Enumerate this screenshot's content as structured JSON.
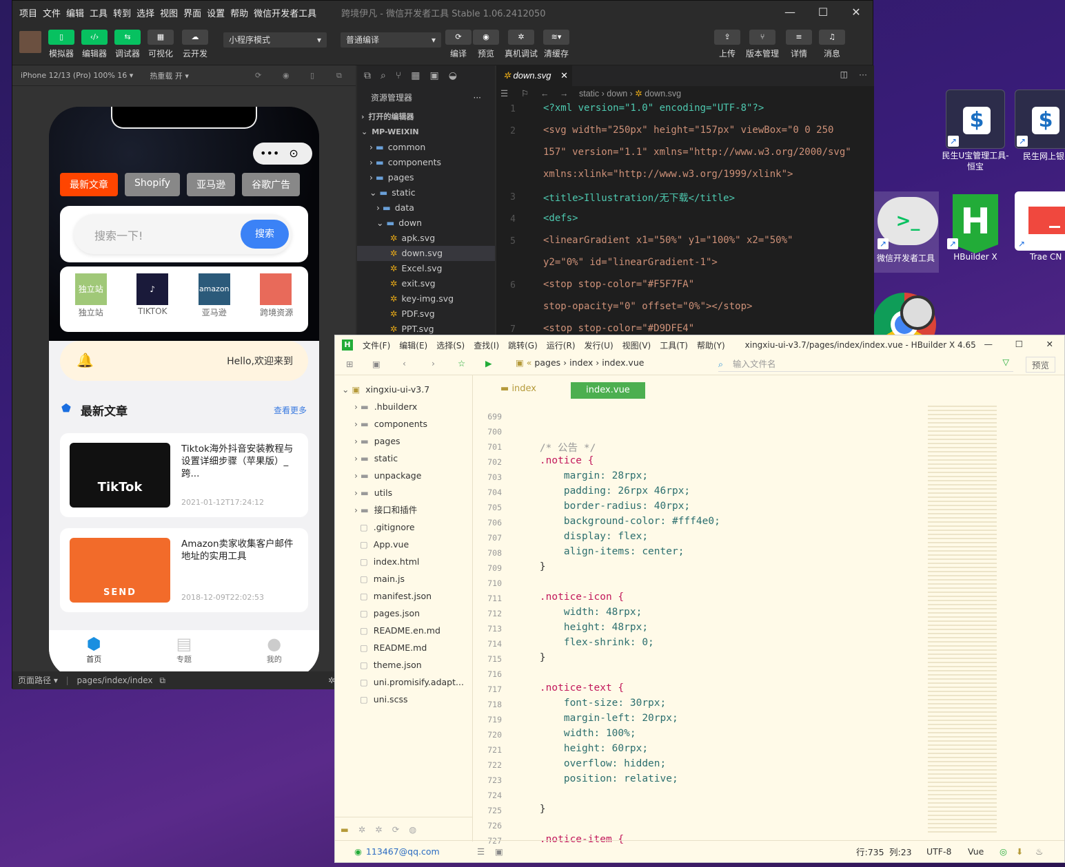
{
  "desktop": {
    "icons": [
      {
        "label": "民生U宝管理工具-恒宝",
        "color": "#ffffff"
      },
      {
        "label": "民生网上银",
        "color": "#ffffff"
      },
      {
        "label": "微信开发者工具",
        "color": "#e6e6e6"
      },
      {
        "label": "HBuilder X",
        "color": "#22ac38"
      },
      {
        "label": "Trae CN",
        "color": "#ffffff"
      }
    ]
  },
  "wx": {
    "menu": [
      "项目",
      "文件",
      "编辑",
      "工具",
      "转到",
      "选择",
      "视图",
      "界面",
      "设置",
      "帮助",
      "微信开发者工具"
    ],
    "title": "跨境伊凡 - 微信开发者工具 Stable 1.06.2412050",
    "toolbar": {
      "simulator": "模拟器",
      "editor": "编辑器",
      "debugger": "调试器",
      "visual": "可视化",
      "cloud": "云开发",
      "mode": "小程序模式",
      "compile_mode": "普通编译",
      "compile": "编译",
      "preview": "预览",
      "real_debug": "真机调试",
      "clear_cache": "清缓存",
      "upload": "上传",
      "version": "版本管理",
      "detail": "详情",
      "message": "消息"
    },
    "sim": {
      "device": "iPhone 12/13 (Pro) 100% 16 ▾",
      "hotreload": "热重载 开 ▾",
      "path_label": "页面路径 ▾",
      "path": "pages/index/index"
    },
    "phone": {
      "tabs": [
        "最新文章",
        "Shopify",
        "亚马逊",
        "谷歌广告"
      ],
      "search_placeholder": "搜索一下!",
      "search_btn": "搜索",
      "grid": [
        {
          "label": "独立站"
        },
        {
          "label": "TIKTOK"
        },
        {
          "label": "亚马逊"
        },
        {
          "label": "跨境资源"
        }
      ],
      "notice": "Hello,欢迎来到",
      "section_title": "最新文章",
      "more": "查看更多",
      "articles": [
        {
          "title": "Tiktok海外抖音安装教程与设置详细步骤（苹果版）_跨...",
          "date": "2021-01-12T17:24:12",
          "thumb": "TikTok"
        },
        {
          "title": "Amazon卖家收集客户邮件地址的实用工具",
          "date": "2018-12-09T22:02:53",
          "thumb": "SEND"
        }
      ],
      "tabbar": [
        "首页",
        "专题",
        "我的"
      ]
    },
    "explorer": {
      "title": "资源管理器",
      "items": [
        {
          "label": "打开的编辑器",
          "depth": 0,
          "kind": "section"
        },
        {
          "label": "MP-WEIXIN",
          "depth": 0,
          "kind": "section"
        },
        {
          "label": "common",
          "depth": 1,
          "kind": "folder"
        },
        {
          "label": "components",
          "depth": 1,
          "kind": "folder"
        },
        {
          "label": "pages",
          "depth": 1,
          "kind": "folder"
        },
        {
          "label": "static",
          "depth": 1,
          "kind": "folder-open"
        },
        {
          "label": "data",
          "depth": 2,
          "kind": "folder"
        },
        {
          "label": "down",
          "depth": 2,
          "kind": "folder-open"
        },
        {
          "label": "apk.svg",
          "depth": 3,
          "kind": "svg"
        },
        {
          "label": "down.svg",
          "depth": 3,
          "kind": "svg",
          "active": true
        },
        {
          "label": "Excel.svg",
          "depth": 3,
          "kind": "svg"
        },
        {
          "label": "exit.svg",
          "depth": 3,
          "kind": "svg"
        },
        {
          "label": "key-img.svg",
          "depth": 3,
          "kind": "svg"
        },
        {
          "label": "PDF.svg",
          "depth": 3,
          "kind": "svg"
        },
        {
          "label": "PPT.svg",
          "depth": 3,
          "kind": "svg"
        }
      ]
    },
    "editor": {
      "tab": "down.svg",
      "breadcrumb": [
        "static",
        "down",
        "down.svg"
      ],
      "lines": [
        {
          "n": "1",
          "text": "<?xml version=\"1.0\" encoding=\"UTF-8\"?>"
        },
        {
          "n": "2",
          "text": "<svg width=\"250px\" height=\"157px\" viewBox=\"0 0 250"
        },
        {
          "n": "",
          "text": "157\" version=\"1.1\" xmlns=\"http://www.w3.org/2000/svg\""
        },
        {
          "n": "",
          "text": "xmlns:xlink=\"http://www.w3.org/1999/xlink\">"
        },
        {
          "n": "3",
          "text": "    <title>Illustration/无下载</title>"
        },
        {
          "n": "4",
          "text": "    <defs>"
        },
        {
          "n": "5",
          "text": "        <linearGradient x1=\"50%\" y1=\"100%\" x2=\"50%\""
        },
        {
          "n": "",
          "text": "        y2=\"0%\" id=\"linearGradient-1\">"
        },
        {
          "n": "6",
          "text": "            <stop stop-color=\"#F5F7FA\""
        },
        {
          "n": "",
          "text": "            stop-opacity=\"0\" offset=\"0%\"></stop>"
        },
        {
          "n": "7",
          "text": "            <stop stop-color=\"#D9DFE4\""
        }
      ]
    }
  },
  "hb": {
    "menu": [
      "文件(F)",
      "编辑(E)",
      "选择(S)",
      "查找(I)",
      "跳转(G)",
      "运行(R)",
      "发行(U)",
      "视图(V)",
      "工具(T)",
      "帮助(Y)"
    ],
    "title": "xingxiu-ui-v3.7/pages/index/index.vue - HBuilder X 4.65",
    "crumbs": [
      "pages",
      "index",
      "index.vue"
    ],
    "file_search": "输入文件名",
    "preview_btn": "预览",
    "tabs": [
      "index",
      "index.vue"
    ],
    "tree": [
      {
        "label": "xingxiu-ui-v3.7",
        "depth": 0,
        "kind": "root"
      },
      {
        "label": ".hbuilderx",
        "depth": 1,
        "kind": "folder"
      },
      {
        "label": "components",
        "depth": 1,
        "kind": "folder"
      },
      {
        "label": "pages",
        "depth": 1,
        "kind": "folder"
      },
      {
        "label": "static",
        "depth": 1,
        "kind": "folder"
      },
      {
        "label": "unpackage",
        "depth": 1,
        "kind": "folder"
      },
      {
        "label": "utils",
        "depth": 1,
        "kind": "folder"
      },
      {
        "label": "接口和插件",
        "depth": 1,
        "kind": "folder"
      },
      {
        "label": ".gitignore",
        "depth": 1,
        "kind": "file"
      },
      {
        "label": "App.vue",
        "depth": 1,
        "kind": "file"
      },
      {
        "label": "index.html",
        "depth": 1,
        "kind": "file"
      },
      {
        "label": "main.js",
        "depth": 1,
        "kind": "file"
      },
      {
        "label": "manifest.json",
        "depth": 1,
        "kind": "file"
      },
      {
        "label": "pages.json",
        "depth": 1,
        "kind": "file"
      },
      {
        "label": "README.en.md",
        "depth": 1,
        "kind": "file"
      },
      {
        "label": "README.md",
        "depth": 1,
        "kind": "file"
      },
      {
        "label": "theme.json",
        "depth": 1,
        "kind": "file"
      },
      {
        "label": "uni.promisify.adapt...",
        "depth": 1,
        "kind": "file"
      },
      {
        "label": "uni.scss",
        "depth": 1,
        "kind": "file"
      }
    ],
    "code": [
      {
        "n": "699",
        "t": ""
      },
      {
        "n": "700",
        "t": ""
      },
      {
        "n": "701",
        "t": "    /* 公告 */"
      },
      {
        "n": "702",
        "t": "    .notice {"
      },
      {
        "n": "703",
        "t": "        margin: 28rpx;"
      },
      {
        "n": "704",
        "t": "        padding: 26rpx 46rpx;"
      },
      {
        "n": "705",
        "t": "        border-radius: 40rpx;"
      },
      {
        "n": "706",
        "t": "        background-color: #fff4e0;"
      },
      {
        "n": "707",
        "t": "        display: flex;"
      },
      {
        "n": "708",
        "t": "        align-items: center;"
      },
      {
        "n": "709",
        "t": "    }"
      },
      {
        "n": "710",
        "t": ""
      },
      {
        "n": "711",
        "t": "    .notice-icon {"
      },
      {
        "n": "712",
        "t": "        width: 48rpx;"
      },
      {
        "n": "713",
        "t": "        height: 48rpx;"
      },
      {
        "n": "714",
        "t": "        flex-shrink: 0;"
      },
      {
        "n": "715",
        "t": "    }"
      },
      {
        "n": "716",
        "t": ""
      },
      {
        "n": "717",
        "t": "    .notice-text {"
      },
      {
        "n": "718",
        "t": "        font-size: 30rpx;"
      },
      {
        "n": "719",
        "t": "        margin-left: 20rpx;"
      },
      {
        "n": "720",
        "t": "        width: 100%;"
      },
      {
        "n": "721",
        "t": "        height: 60rpx;"
      },
      {
        "n": "722",
        "t": "        overflow: hidden;"
      },
      {
        "n": "723",
        "t": "        position: relative;"
      },
      {
        "n": "724",
        "t": ""
      },
      {
        "n": "725",
        "t": "    }"
      },
      {
        "n": "726",
        "t": ""
      },
      {
        "n": "727",
        "t": "    .notice-item {"
      }
    ],
    "status": {
      "user": "113467@qq.com",
      "pos": "行:735",
      "col": "列:23",
      "enc": "UTF-8",
      "lang": "Vue"
    }
  }
}
